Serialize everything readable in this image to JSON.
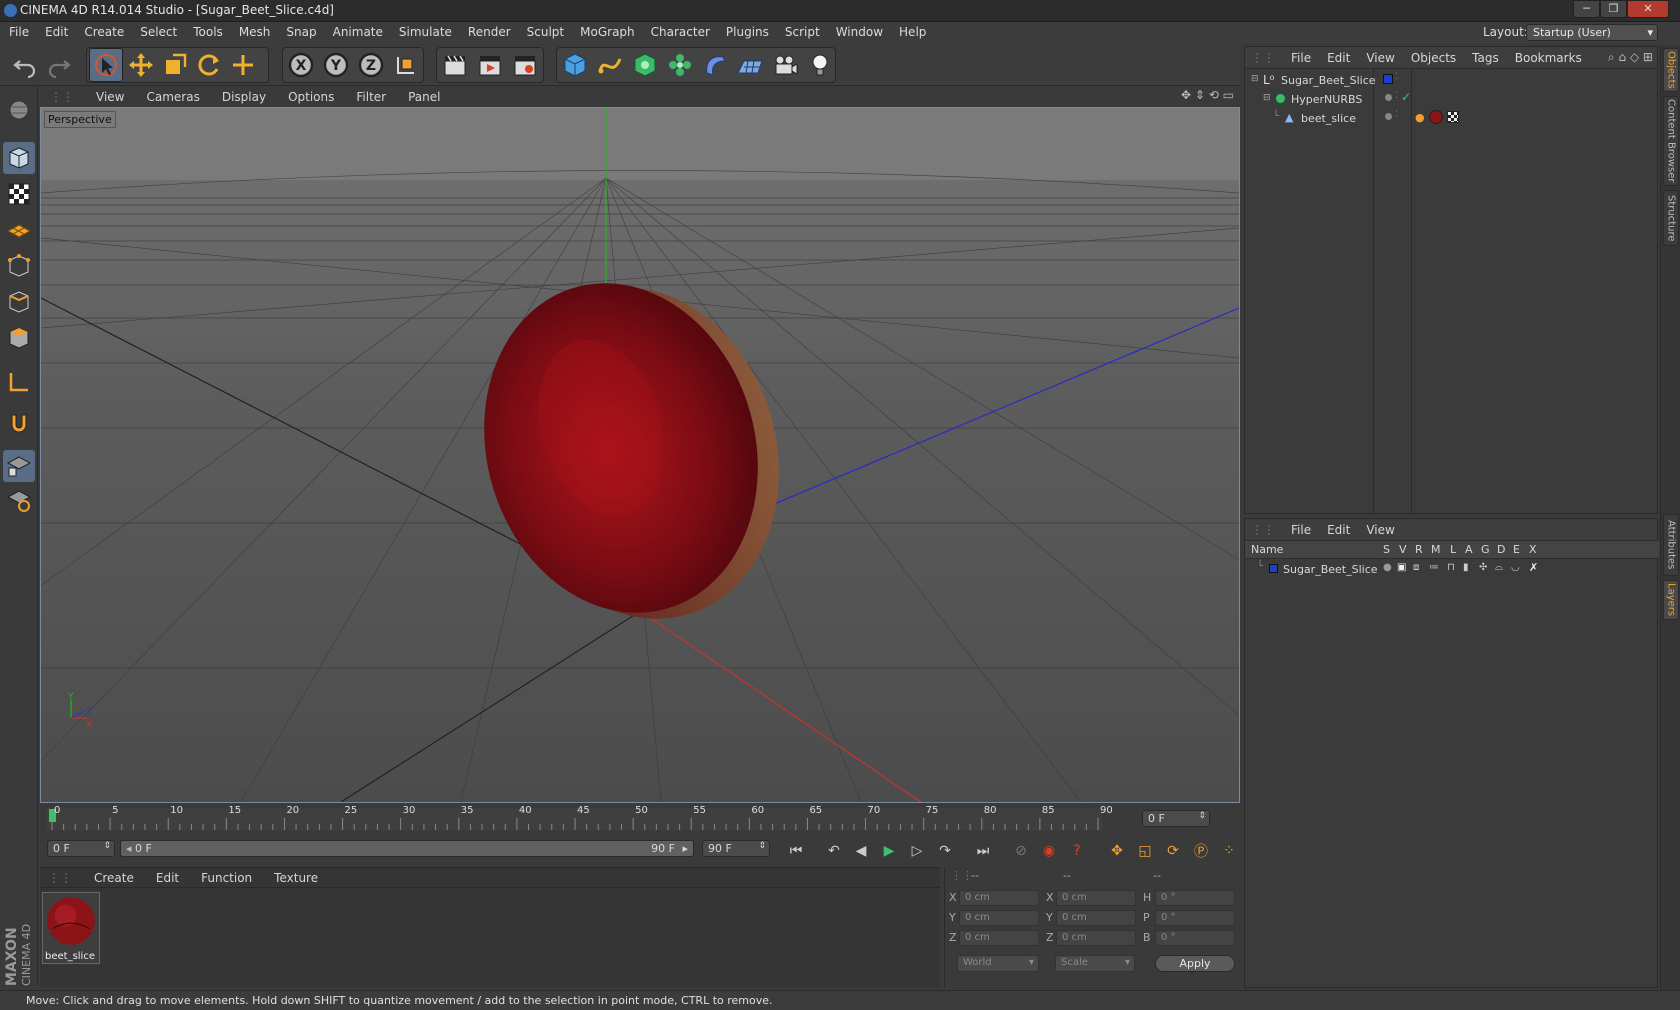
{
  "window": {
    "title": "CINEMA 4D R14.014 Studio - [Sugar_Beet_Slice.c4d]",
    "min": "─",
    "max": "❐",
    "close": "✕"
  },
  "menu": [
    "File",
    "Edit",
    "Create",
    "Select",
    "Tools",
    "Mesh",
    "Snap",
    "Animate",
    "Simulate",
    "Render",
    "Sculpt",
    "MoGraph",
    "Character",
    "Plugins",
    "Script",
    "Window",
    "Help"
  ],
  "layout": {
    "label": "Layout:",
    "value": "Startup (User)"
  },
  "viewport": {
    "menu": [
      "View",
      "Cameras",
      "Display",
      "Options",
      "Filter",
      "Panel"
    ],
    "label": "Perspective",
    "axis": {
      "y": "Y",
      "z": "Z",
      "x": "X"
    }
  },
  "timeline": {
    "ticks": [
      "0",
      "5",
      "10",
      "15",
      "20",
      "25",
      "30",
      "35",
      "40",
      "45",
      "50",
      "55",
      "60",
      "65",
      "70",
      "75",
      "80",
      "85",
      "90"
    ],
    "current_frame": "0 F"
  },
  "playbar": {
    "start": "0 F",
    "range_start": "0 F",
    "range_end": "90 F",
    "end": "90 F"
  },
  "materials": {
    "menu": [
      "Create",
      "Edit",
      "Function",
      "Texture"
    ],
    "items": [
      {
        "name": "beet_slice"
      }
    ]
  },
  "coordinates": {
    "headers": [
      "--",
      "--",
      "--"
    ],
    "rows": [
      {
        "l1": "X",
        "v1": "0 cm",
        "l2": "X",
        "v2": "0 cm",
        "l3": "H",
        "v3": "0 °"
      },
      {
        "l1": "Y",
        "v1": "0 cm",
        "l2": "Y",
        "v2": "0 cm",
        "l3": "P",
        "v3": "0 °"
      },
      {
        "l1": "Z",
        "v1": "0 cm",
        "l2": "Z",
        "v2": "0 cm",
        "l3": "B",
        "v3": "0 °"
      }
    ],
    "space": "World",
    "mode": "Scale",
    "apply": "Apply"
  },
  "objects_panel": {
    "menu": [
      "File",
      "Edit",
      "View",
      "Objects",
      "Tags",
      "Bookmarks"
    ],
    "tree": [
      {
        "name": "Sugar_Beet_Slice"
      },
      {
        "name": "HyperNURBS"
      },
      {
        "name": "beet_slice"
      }
    ]
  },
  "layers_panel": {
    "menu": [
      "File",
      "Edit",
      "View"
    ],
    "columns": [
      "Name",
      "S",
      "V",
      "R",
      "M",
      "L",
      "A",
      "G",
      "D",
      "E",
      "X"
    ],
    "rows": [
      {
        "name": "Sugar_Beet_Slice"
      }
    ]
  },
  "side_tabs": [
    "Objects",
    "Content Browser",
    "Structure",
    "Attributes",
    "Layers"
  ],
  "brand": {
    "line1": "MAXON",
    "line2": "CINEMA 4D"
  },
  "status": "Move: Click and drag to move elements. Hold down SHIFT to quantize movement / add to the selection in point mode, CTRL to remove.",
  "colors": {
    "accent": "#f0a030",
    "selection": "#5a6d86",
    "beet": "#8c1418",
    "axis_x": "#c83232",
    "axis_y": "#28b428",
    "axis_z": "#3232c8"
  }
}
